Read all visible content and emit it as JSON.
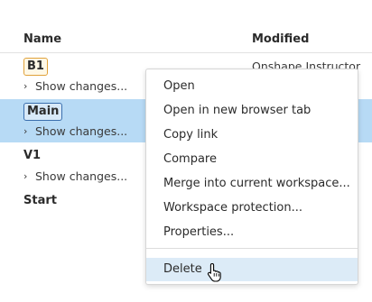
{
  "table": {
    "headers": {
      "name": "Name",
      "modified": "Modified"
    },
    "rows": [
      {
        "badge": "B1",
        "show_changes": "Show changes...",
        "modified": "Onshape Instructor"
      },
      {
        "badge": "Main",
        "show_changes": "Show changes...",
        "selected": true
      },
      {
        "name": "V1",
        "show_changes": "Show changes..."
      },
      {
        "name": "Start"
      }
    ]
  },
  "context_menu": {
    "items": [
      {
        "label": "Open"
      },
      {
        "label": "Open in new browser tab"
      },
      {
        "label": "Copy link"
      },
      {
        "label": "Compare"
      },
      {
        "label": "Merge into current workspace..."
      },
      {
        "label": "Workspace protection..."
      },
      {
        "label": "Properties..."
      },
      {
        "label": "Delete",
        "hovered": true
      }
    ]
  },
  "icons": {
    "chevron": "chevron-right-icon",
    "cursor": "hand-pointer-cursor-icon"
  },
  "colors": {
    "selected_row": "#b7daf5",
    "hover_item": "#dcebf7",
    "b1_badge_border": "#e0a23b",
    "main_badge_border": "#3b6fae"
  }
}
